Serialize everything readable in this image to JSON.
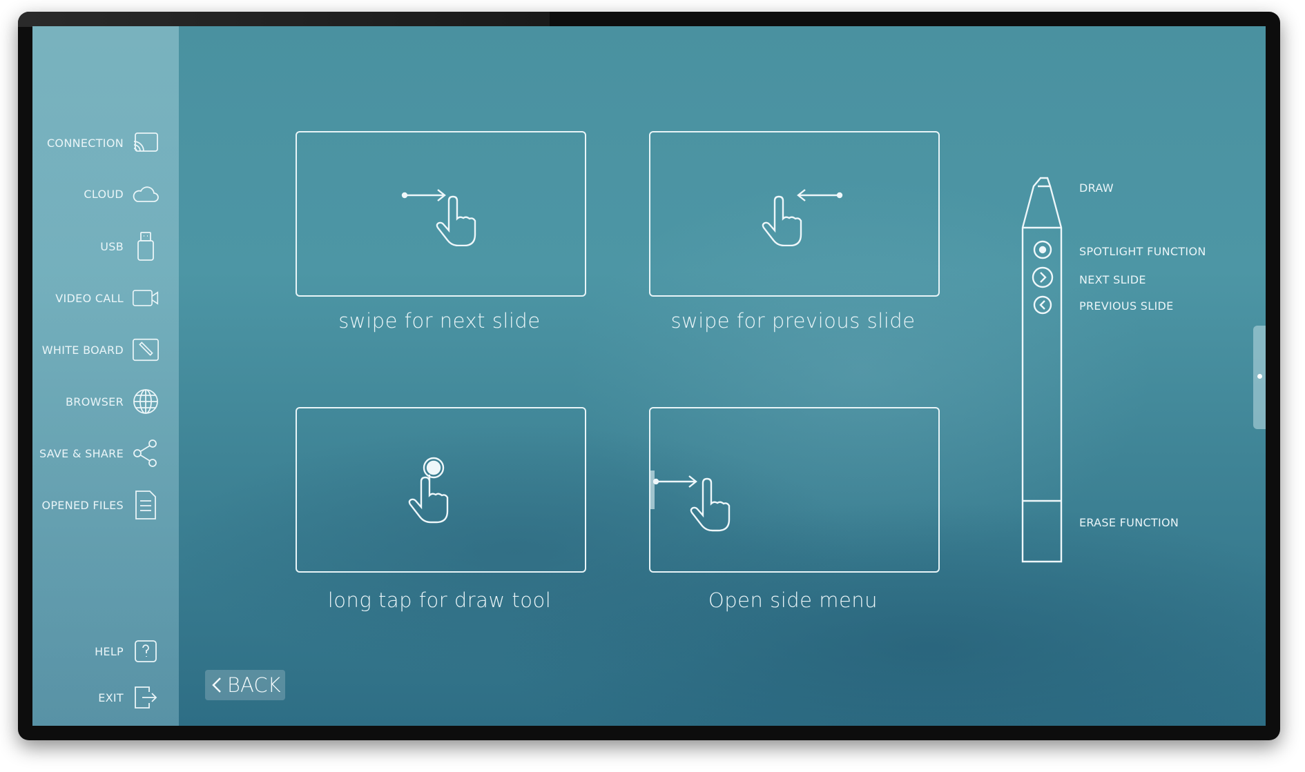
{
  "sidebar": {
    "items": [
      {
        "label": "CONNECTION",
        "icon": "cast-icon"
      },
      {
        "label": "CLOUD",
        "icon": "cloud-icon"
      },
      {
        "label": "USB",
        "icon": "usb-icon"
      },
      {
        "label": "VIDEO CALL",
        "icon": "video-camera-icon"
      },
      {
        "label": "WHITE BOARD",
        "icon": "pencil-board-icon"
      },
      {
        "label": "BROWSER",
        "icon": "globe-icon"
      },
      {
        "label": "SAVE & SHARE",
        "icon": "share-icon"
      },
      {
        "label": "OPENED FILES",
        "icon": "document-icon"
      },
      {
        "label": "HELP",
        "icon": "question-icon"
      },
      {
        "label": "EXIT",
        "icon": "exit-icon"
      }
    ]
  },
  "gestures": [
    {
      "caption": "swipe for next slide",
      "icon": "swipe-right-hand-icon"
    },
    {
      "caption": "swipe for previous slide",
      "icon": "swipe-left-hand-icon"
    },
    {
      "caption": "long tap for draw tool",
      "icon": "long-tap-hand-icon"
    },
    {
      "caption": "Open side menu",
      "icon": "edge-swipe-hand-icon"
    }
  ],
  "pen": {
    "draw": "DRAW",
    "spotlight": "SPOTLIGHT FUNCTION",
    "next": "NEXT SLIDE",
    "previous": "PREVIOUS SLIDE",
    "erase": "ERASE FUNCTION"
  },
  "back_button": {
    "label": "BACK"
  },
  "colors": {
    "background": "#4a91a0",
    "sidebar": "#9ccad6",
    "line": "#eef7fa"
  }
}
